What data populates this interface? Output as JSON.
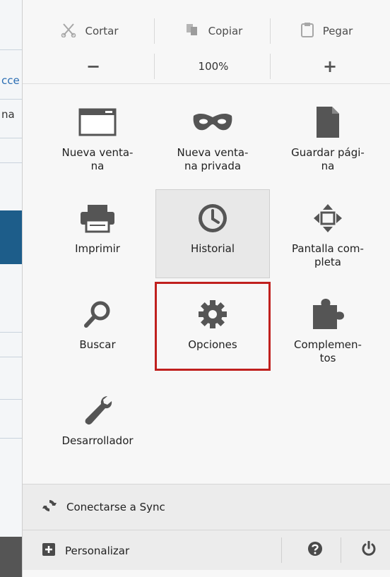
{
  "background_page": {
    "fragments": [
      "cce",
      "na"
    ]
  },
  "edit": {
    "cut_label": "Cortar",
    "copy_label": "Copiar",
    "paste_label": "Pegar"
  },
  "zoom": {
    "decrease": "−",
    "level": "100%",
    "increase": "+"
  },
  "tiles": [
    {
      "label": "Nueva venta-\nna",
      "icon": "new-window-icon"
    },
    {
      "label": "Nueva venta-\nna privada",
      "icon": "private-mask-icon"
    },
    {
      "label": "Guardar pági-\nna",
      "icon": "save-page-icon"
    },
    {
      "label": "Imprimir",
      "icon": "printer-icon"
    },
    {
      "label": "Historial",
      "icon": "history-clock-icon"
    },
    {
      "label": "Pantalla com-\npleta",
      "icon": "fullscreen-icon"
    },
    {
      "label": "Buscar",
      "icon": "search-icon"
    },
    {
      "label": "Opciones",
      "icon": "gear-icon"
    },
    {
      "label": "Complemen-\ntos",
      "icon": "puzzle-icon"
    },
    {
      "label": "Desarrollador",
      "icon": "wrench-icon"
    }
  ],
  "footer": {
    "sync_label": "Conectarse a Sync",
    "customize_label": "Personalizar",
    "help_icon": "help-icon",
    "quit_icon": "power-icon"
  },
  "colors": {
    "highlight": "#c0201e",
    "icon": "#555555"
  }
}
